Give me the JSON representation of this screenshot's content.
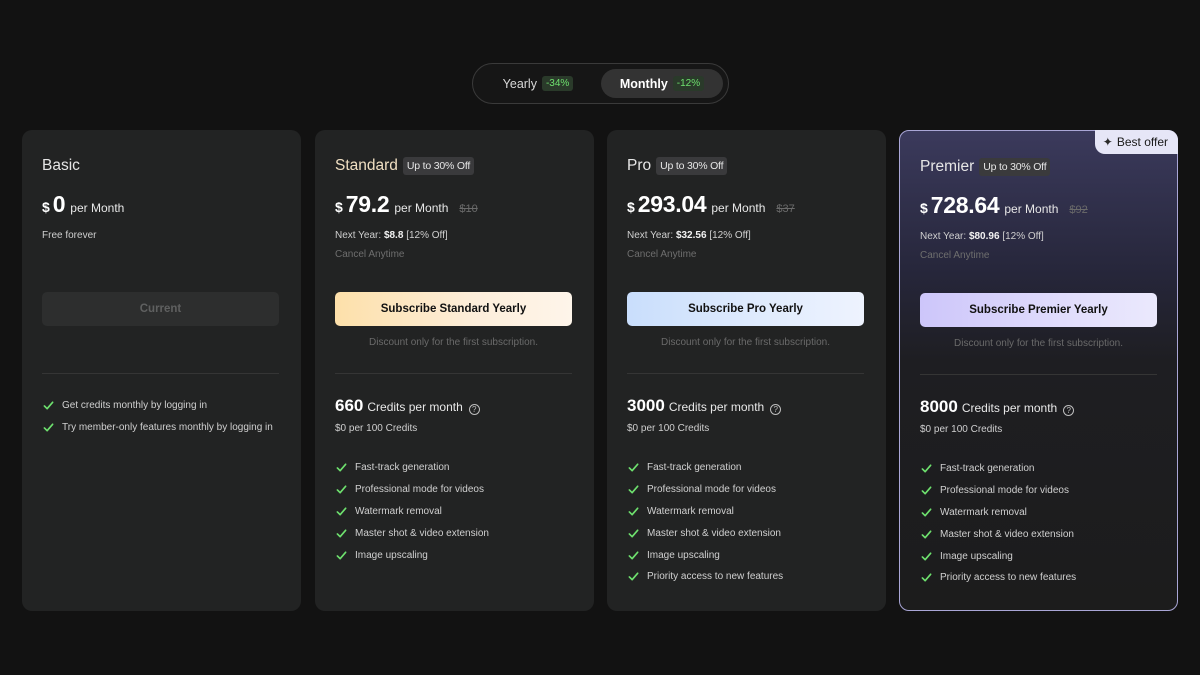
{
  "billing_toggle": {
    "yearly_label": "Yearly",
    "yearly_discount": "-34%",
    "monthly_label": "Monthly",
    "monthly_discount": "-12%",
    "selected": "Monthly"
  },
  "colors": {
    "discount_green": "#6ee16e",
    "check_green": "#6ee16e",
    "premier_border": "#a9a6d6"
  },
  "icons": {
    "best_offer": "sparkle-icon",
    "feature": "check-icon",
    "credits_help": "question-circle-icon"
  },
  "plans": [
    {
      "name": "Basic",
      "currency": "$",
      "price": "0",
      "per": "per Month",
      "note": "Free forever",
      "cta": "Current",
      "features": [
        "Get credits monthly by logging in",
        "Try member-only features monthly by logging in"
      ]
    },
    {
      "name": "Standard",
      "badge": "Up to 30% Off",
      "currency": "$",
      "price": "79.2",
      "per": "per Month",
      "old_price": "$10",
      "next_year_label": "Next Year:",
      "next_year_price": "$8.8",
      "next_year_suffix": "[12% Off]",
      "cancel": "Cancel Anytime",
      "cta": "Subscribe Standard Yearly",
      "discount_note": "Discount only for the first subscription.",
      "credits": "660",
      "credits_label": "Credits per month",
      "per_credit": "$0 per 100 Credits",
      "features": [
        "Fast-track generation",
        "Professional mode for videos",
        "Watermark removal",
        "Master shot & video extension",
        "Image upscaling"
      ]
    },
    {
      "name": "Pro",
      "badge": "Up to 30% Off",
      "currency": "$",
      "price": "293.04",
      "per": "per Month",
      "old_price": "$37",
      "next_year_label": "Next Year:",
      "next_year_price": "$32.56",
      "next_year_suffix": "[12% Off]",
      "cancel": "Cancel Anytime",
      "cta": "Subscribe Pro Yearly",
      "discount_note": "Discount only for the first subscription.",
      "credits": "3000",
      "credits_label": "Credits per month",
      "per_credit": "$0 per 100 Credits",
      "features": [
        "Fast-track generation",
        "Professional mode for videos",
        "Watermark removal",
        "Master shot & video extension",
        "Image upscaling",
        "Priority access to new features"
      ]
    },
    {
      "name": "Premier",
      "badge": "Up to 30% Off",
      "ribbon": "Best offer",
      "currency": "$",
      "price": "728.64",
      "per": "per Month",
      "old_price": "$92",
      "next_year_label": "Next Year:",
      "next_year_price": "$80.96",
      "next_year_suffix": "[12% Off]",
      "cancel": "Cancel Anytime",
      "cta": "Subscribe Premier Yearly",
      "discount_note": "Discount only for the first subscription.",
      "credits": "8000",
      "credits_label": "Credits per month",
      "per_credit": "$0 per 100 Credits",
      "features": [
        "Fast-track generation",
        "Professional mode for videos",
        "Watermark removal",
        "Master shot & video extension",
        "Image upscaling",
        "Priority access to new features"
      ]
    }
  ]
}
